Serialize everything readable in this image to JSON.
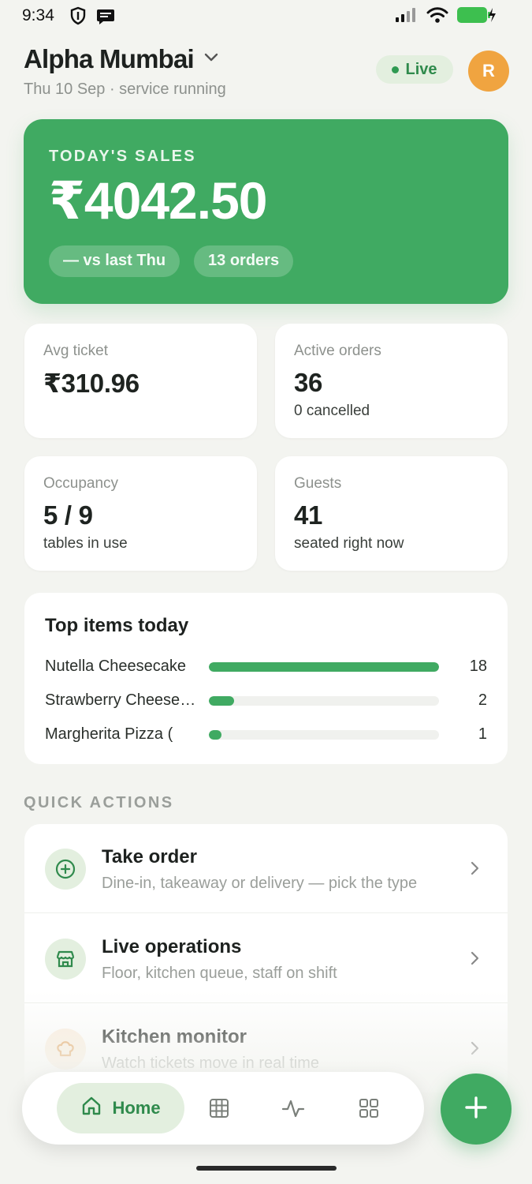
{
  "status_bar": {
    "time": "9:34"
  },
  "header": {
    "venue_name": "Alpha Mumbai",
    "subtitle": "Thu 10 Sep · service running",
    "live_label": "Live",
    "avatar_initial": "R"
  },
  "sales": {
    "label": "TODAY'S SALES",
    "amount": "₹4042.50",
    "comparison": "— vs last Thu",
    "orders": "13 orders"
  },
  "stats": {
    "avg_ticket": {
      "label": "Avg ticket",
      "value": "₹310.96"
    },
    "active_orders": {
      "label": "Active orders",
      "value": "36",
      "sub": "0 cancelled"
    },
    "occupancy": {
      "label": "Occupancy",
      "value": "5 / 9",
      "sub": "tables in use"
    },
    "guests": {
      "label": "Guests",
      "value": "41",
      "sub": "seated right now"
    }
  },
  "top_items": {
    "title": "Top items today",
    "items": [
      {
        "name": "Nutella Cheesecake",
        "count": 18
      },
      {
        "name": "Strawberry Cheesecake",
        "count": 2
      },
      {
        "name": "Margherita Pizza (",
        "count": 1
      }
    ]
  },
  "quick_actions": {
    "label": "QUICK ACTIONS",
    "items": [
      {
        "title": "Take order",
        "subtitle": "Dine-in, takeaway or delivery — pick the type"
      },
      {
        "title": "Live operations",
        "subtitle": "Floor, kitchen queue, staff on shift"
      },
      {
        "title": "Kitchen monitor",
        "subtitle": "Watch tickets move in real time"
      }
    ]
  },
  "bottom_nav": {
    "home_label": "Home"
  },
  "colors": {
    "accent": "#40aa62",
    "accent_light": "#e3efdf",
    "avatar": "#f0a440"
  }
}
